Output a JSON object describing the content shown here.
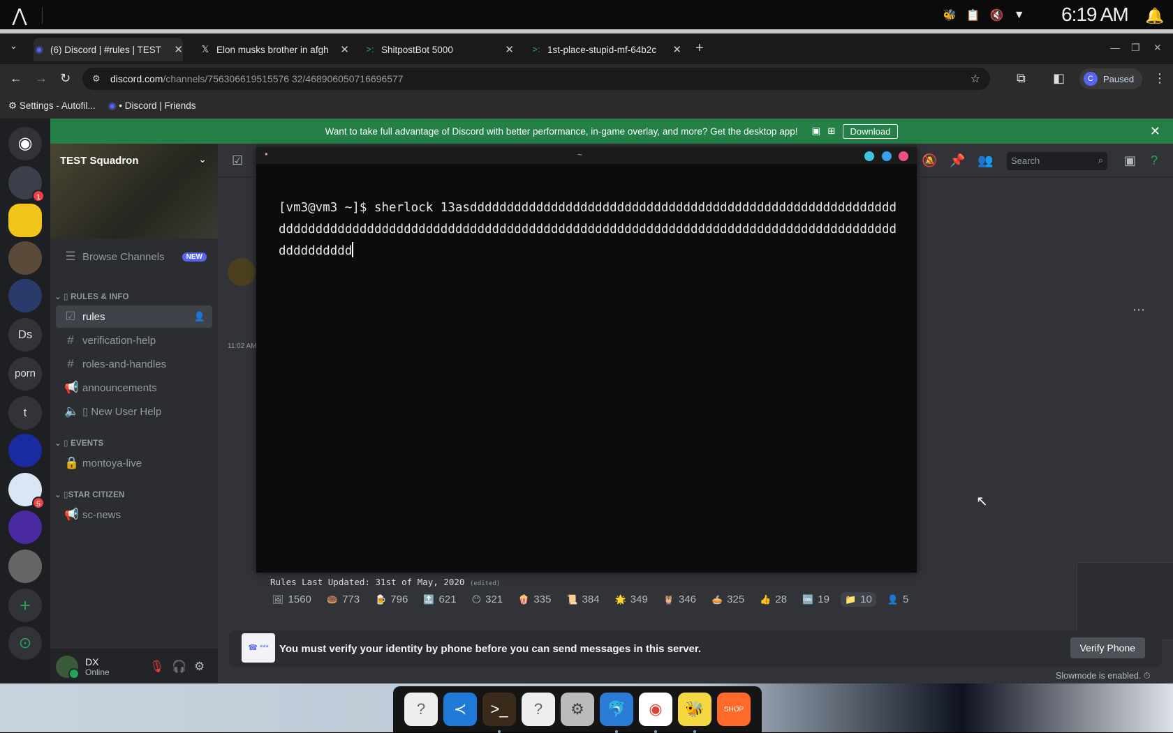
{
  "system": {
    "clock": "6:19 AM"
  },
  "browser": {
    "tabs": [
      {
        "title": "(6) Discord | #rules | TEST"
      },
      {
        "title": "Elon musks brother in afgh"
      },
      {
        "title": "ShitpostBot 5000"
      },
      {
        "title": "1st-place-stupid-mf-64b2c"
      }
    ],
    "url_host": "discord.com",
    "url_path": "/channels/756306619515576 32/468906050716696577",
    "profile_status": "Paused",
    "profile_initial": "C",
    "bookmarks": [
      "Settings - Autofil...",
      "• Discord | Friends"
    ]
  },
  "discord": {
    "banner_text": "Want to take full advantage of Discord with better performance, in-game overlay, and more? Get the desktop app!",
    "banner_button": "Download",
    "servers": [
      {
        "label": "",
        "badge": "1"
      },
      {
        "label": "",
        "badge": ""
      },
      {
        "label": "",
        "badge": ""
      },
      {
        "label": "",
        "badge": ""
      },
      {
        "label": "Ds",
        "badge": ""
      },
      {
        "label": "porn",
        "badge": ""
      },
      {
        "label": "t",
        "badge": ""
      },
      {
        "label": "",
        "badge": ""
      },
      {
        "label": "",
        "badge": "5"
      },
      {
        "label": "",
        "badge": ""
      },
      {
        "label": "",
        "badge": ""
      }
    ],
    "server_name": "TEST Squadron",
    "browse_channels": "Browse Channels",
    "new_tag": "NEW",
    "categories": {
      "rules_info": "▯ RULES & INFO",
      "events": "▯ EVENTS",
      "star_citizen": "▯STAR CITIZEN"
    },
    "channels": {
      "rules": "rules",
      "verification_help": "verification-help",
      "roles_and_handles": "roles-and-handles",
      "announcements": "announcements",
      "new_user_help": "▯ New User Help",
      "montoya_live": "montoya-live",
      "sc_news": "sc-news"
    },
    "user": {
      "name": "DX",
      "status": "Online"
    },
    "search_placeholder": "Search",
    "message_time": "11:02 AM",
    "rules_updated": "Rules Last Updated: 31st of May, 2020",
    "edited": "(edited)",
    "reactions": [
      "1560",
      "773",
      "796",
      "621",
      "321",
      "335",
      "384",
      "349",
      "346",
      "325",
      "28",
      "19",
      "10",
      "5"
    ],
    "reaction_emojis": [
      "🖼",
      "🍩",
      "🍺",
      "🔝",
      "😶",
      "🍿",
      "📜",
      "🌟",
      "🦉",
      "🥧",
      "👍",
      "🆒",
      "📁",
      "👤"
    ],
    "verify_text": "You must verify your identity by phone before you can send messages in this server.",
    "verify_button": "Verify Phone",
    "slowmode": "Slowmode is enabled."
  },
  "terminal": {
    "title": "~",
    "prompt": "[vm3@vm3 ~]$ ",
    "command": "sherlock 13asdddddddddddddddddddddddddddddddddddddddddddddddddddddddddddddddddddddddddddddddddddddddddddddddddddddddddddddddddddddddddddddddddddddddddddddddddddddddd"
  },
  "colors": {
    "discord_green": "#248046",
    "blurple": "#5865f2",
    "terminal_bg": "#0c0c0c"
  }
}
